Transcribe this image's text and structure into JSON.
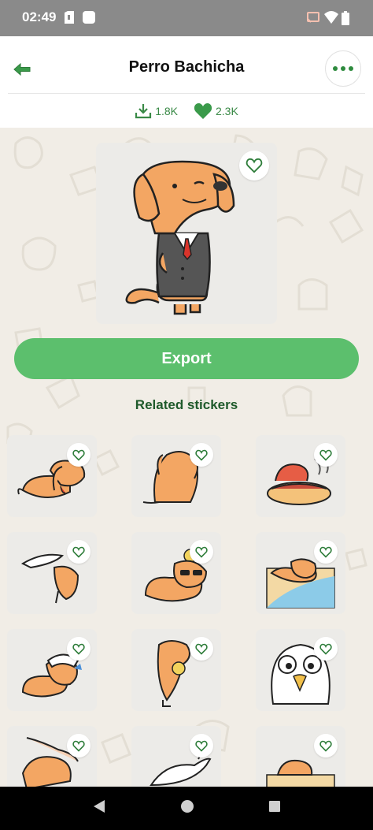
{
  "status_bar": {
    "time": "02:49"
  },
  "header": {
    "title": "Perro Bachicha",
    "back_icon": "arrow-left-icon",
    "more_icon": "more-horizontal-icon"
  },
  "stats": {
    "downloads": "1.8K",
    "likes": "2.3K"
  },
  "main_sticker": {
    "favorited": false
  },
  "export_label": "Export",
  "related_title": "Related stickers",
  "colors": {
    "accent": "#5cbf6d",
    "accent_dark": "#2e8b3e",
    "background": "#f1ede6",
    "tile": "#ecebe8",
    "dog": "#f3a663"
  },
  "related_stickers": [
    {
      "id": "dog-lying"
    },
    {
      "id": "dog-sitting-back"
    },
    {
      "id": "hotdog"
    },
    {
      "id": "dog-seagull"
    },
    {
      "id": "dog-sunglasses"
    },
    {
      "id": "dog-beach"
    },
    {
      "id": "dog-sailor"
    },
    {
      "id": "dog-dollar"
    },
    {
      "id": "seagull-face"
    },
    {
      "id": "dog-pet-hand"
    },
    {
      "id": "cockatoo"
    },
    {
      "id": "dog-peek"
    }
  ]
}
